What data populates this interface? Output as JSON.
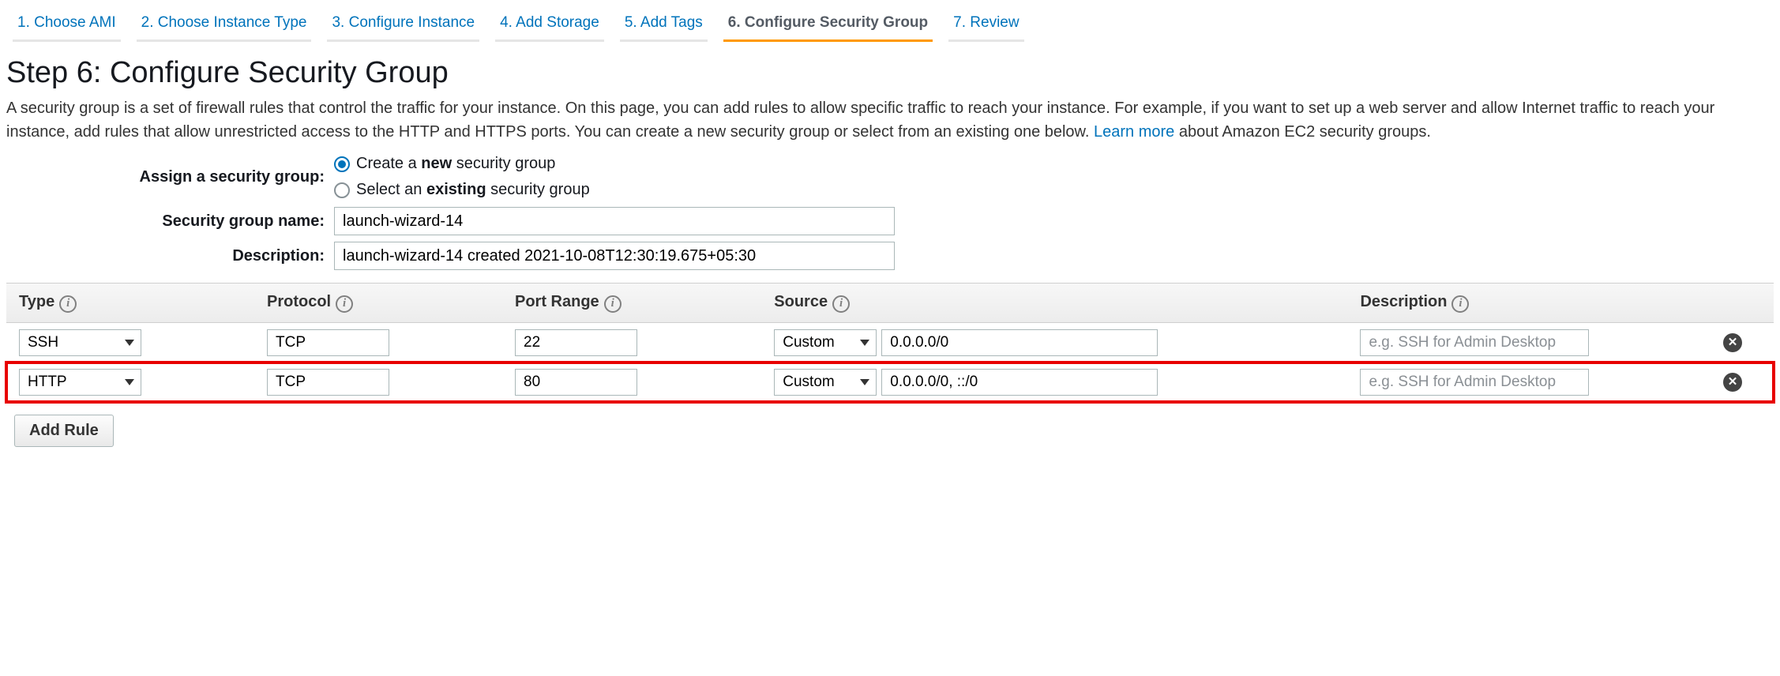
{
  "wizard": {
    "steps": [
      "1. Choose AMI",
      "2. Choose Instance Type",
      "3. Configure Instance",
      "4. Add Storage",
      "5. Add Tags",
      "6. Configure Security Group",
      "7. Review"
    ],
    "active_index": 5
  },
  "page": {
    "title": "Step 6: Configure Security Group",
    "intro_part1": "A security group is a set of firewall rules that control the traffic for your instance. On this page, you can add rules to allow specific traffic to reach your instance. For example, if you want to set up a web server and allow Internet traffic to reach your instance, add rules that allow unrestricted access to the HTTP and HTTPS ports. You can create a new security group or select from an existing one below. ",
    "learn_more": "Learn more",
    "intro_part2": " about Amazon EC2 security groups."
  },
  "assign": {
    "label": "Assign a security group:",
    "create_pre": "Create a ",
    "create_bold": "new",
    "create_post": " security group",
    "select_pre": "Select an ",
    "select_bold": "existing",
    "select_post": " security group",
    "selected": "create"
  },
  "form": {
    "name_label": "Security group name:",
    "name_value": "launch-wizard-14",
    "desc_label": "Description:",
    "desc_value": "launch-wizard-14 created 2021-10-08T12:30:19.675+05:30"
  },
  "table": {
    "headers": {
      "type": "Type",
      "protocol": "Protocol",
      "port_range": "Port Range",
      "source": "Source",
      "description": "Description"
    },
    "desc_placeholder": "e.g. SSH for Admin Desktop",
    "rows": [
      {
        "type": "SSH",
        "protocol": "TCP",
        "port_range": "22",
        "source_mode": "Custom",
        "source_value": "0.0.0.0/0",
        "description": "",
        "highlighted": false
      },
      {
        "type": "HTTP",
        "protocol": "TCP",
        "port_range": "80",
        "source_mode": "Custom",
        "source_value": "0.0.0.0/0, ::/0",
        "description": "",
        "highlighted": true
      }
    ]
  },
  "add_rule_label": "Add Rule"
}
